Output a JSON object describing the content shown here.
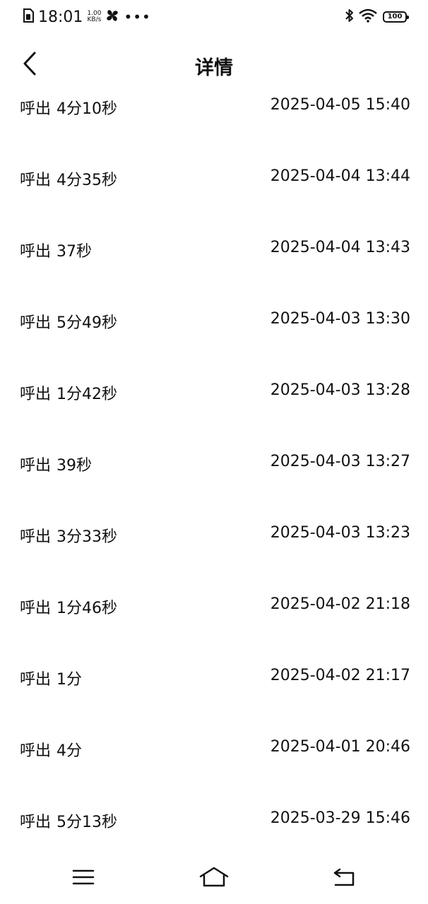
{
  "status_bar": {
    "time": "18:01",
    "speed_value": "1.00",
    "speed_unit": "KB/s",
    "more": "•••",
    "battery": "100"
  },
  "header": {
    "title": "详情"
  },
  "calls": [
    {
      "type": "呼出",
      "duration": "4分10秒",
      "time": "2025-04-05 15:40"
    },
    {
      "type": "呼出",
      "duration": "4分35秒",
      "time": "2025-04-04 13:44"
    },
    {
      "type": "呼出",
      "duration": "37秒",
      "time": "2025-04-04 13:43"
    },
    {
      "type": "呼出",
      "duration": "5分49秒",
      "time": "2025-04-03 13:30"
    },
    {
      "type": "呼出",
      "duration": "1分42秒",
      "time": "2025-04-03 13:28"
    },
    {
      "type": "呼出",
      "duration": "39秒",
      "time": "2025-04-03 13:27"
    },
    {
      "type": "呼出",
      "duration": "3分33秒",
      "time": "2025-04-03 13:23"
    },
    {
      "type": "呼出",
      "duration": "1分46秒",
      "time": "2025-04-02 21:18"
    },
    {
      "type": "呼出",
      "duration": "1分",
      "time": "2025-04-02 21:17"
    },
    {
      "type": "呼出",
      "duration": "4分",
      "time": "2025-04-01 20:46"
    },
    {
      "type": "呼出",
      "duration": "5分13秒",
      "time": "2025-03-29 15:46"
    }
  ],
  "nav": {
    "icons": [
      "menu-icon",
      "home-icon",
      "back-icon"
    ]
  }
}
